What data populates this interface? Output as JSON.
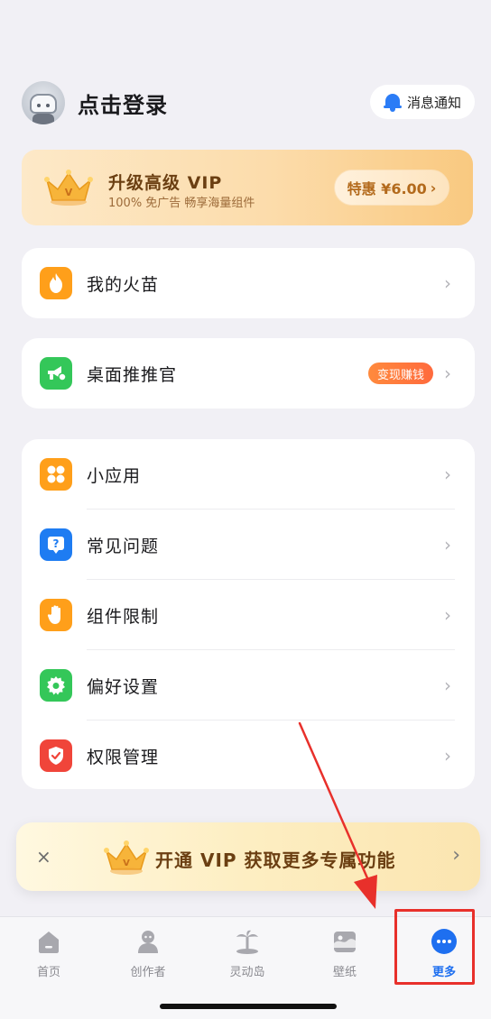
{
  "header": {
    "login_text": "点击登录",
    "notify_label": "消息通知"
  },
  "vip_banner": {
    "title": "升级高级 VIP",
    "subtitle": "100% 免广告  畅享海量组件",
    "price_label": "特惠 ¥6.00",
    "crown_letter": "V"
  },
  "menu_single_1": {
    "label": "我的火苗",
    "icon": "flame-icon",
    "color": "#ff9f1a"
  },
  "menu_single_2": {
    "label": "桌面推推官",
    "icon": "megaphone-icon",
    "color": "#34c759",
    "badge": "变现赚钱"
  },
  "menu_list": [
    {
      "label": "小应用",
      "icon": "apps-icon",
      "color": "#ff9f1a"
    },
    {
      "label": "常见问题",
      "icon": "question-icon",
      "color": "#1e7cf2"
    },
    {
      "label": "组件限制",
      "icon": "hand-icon",
      "color": "#ff9f1a"
    },
    {
      "label": "偏好设置",
      "icon": "gear-icon",
      "color": "#34c759"
    },
    {
      "label": "权限管理",
      "icon": "shield-icon",
      "color": "#f0453a"
    }
  ],
  "vip_strip": {
    "text": "开通 VIP 获取更多专属功能",
    "close": "×",
    "chevron": "›"
  },
  "tabs": [
    {
      "label": "首页",
      "icon": "home-icon",
      "active": false
    },
    {
      "label": "创作者",
      "icon": "creator-icon",
      "active": false
    },
    {
      "label": "灵动岛",
      "icon": "island-icon",
      "active": false
    },
    {
      "label": "壁纸",
      "icon": "wallpaper-icon",
      "active": false
    },
    {
      "label": "更多",
      "icon": "more-icon",
      "active": true
    }
  ],
  "colors": {
    "accent": "#1e6ff0",
    "annotation": "#e8302b",
    "vip_text": "#6b3f12"
  }
}
